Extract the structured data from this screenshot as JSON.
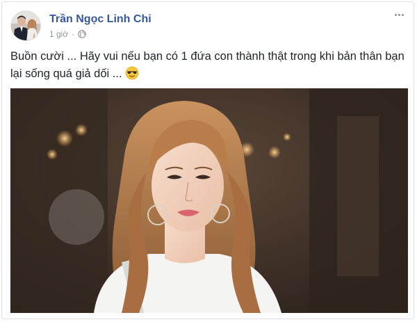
{
  "post": {
    "author": "Trần Ngọc Linh Chi",
    "time": "1 giờ",
    "separator": "·",
    "privacy_icon": "globe-icon",
    "text_line1": "Buồn cười ... Hãy vui nếu bạn có 1 đứa con thành thật trong khi bản thân bạn",
    "text_line2": "lại sống quá giả dối ...",
    "emoji": "sunglasses-emoji",
    "options_icon": "more-options-icon"
  },
  "colors": {
    "author_link": "#365899",
    "meta_text": "#90949c",
    "body_text": "#1d2129",
    "border": "#dddfe2"
  }
}
